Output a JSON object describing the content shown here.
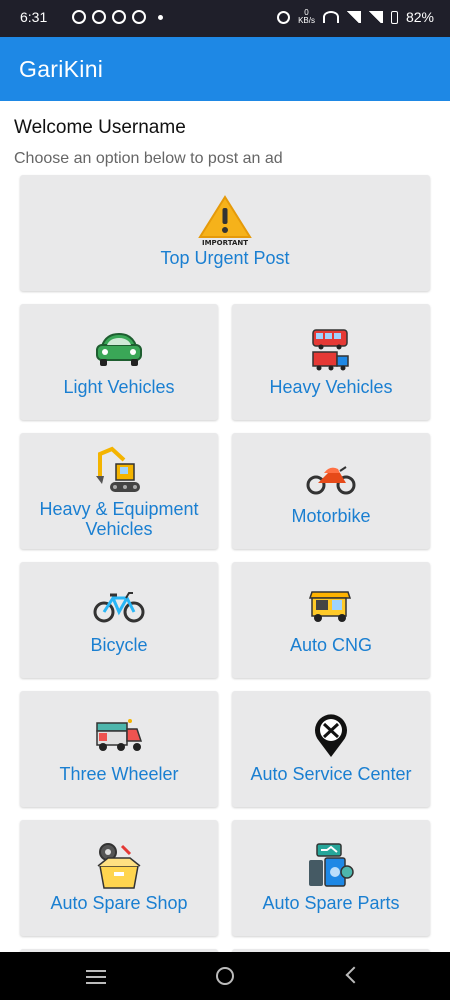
{
  "status_bar": {
    "time": "6:31",
    "network_speed_value": "0",
    "network_speed_unit": "KB/s",
    "battery": "82%"
  },
  "app_bar": {
    "title": "GariKini"
  },
  "header": {
    "welcome": "Welcome Username",
    "subtitle": "Choose an option below to post an ad"
  },
  "top_card": {
    "label": "Top Urgent Post",
    "icon": "warning-icon",
    "icon_text": "IMPORTANT"
  },
  "categories": [
    {
      "label": "Light Vehicles",
      "icon": "car-icon"
    },
    {
      "label": "Heavy Vehicles",
      "icon": "bus-truck-icon"
    },
    {
      "label": "Heavy & Equipment Vehicles",
      "icon": "excavator-icon"
    },
    {
      "label": "Motorbike",
      "icon": "motorbike-icon"
    },
    {
      "label": "Bicycle",
      "icon": "bicycle-icon"
    },
    {
      "label": "Auto CNG",
      "icon": "auto-rickshaw-icon"
    },
    {
      "label": "Three Wheeler",
      "icon": "three-wheeler-icon"
    },
    {
      "label": "Auto Service Center",
      "icon": "service-location-icon"
    },
    {
      "label": "Auto Spare Shop",
      "icon": "spare-box-icon"
    },
    {
      "label": "Auto Spare Parts",
      "icon": "engine-parts-icon"
    }
  ],
  "colors": {
    "app_bar": "#1e88e5",
    "card_background": "#e9e9ea",
    "card_label": "#1a7fd1"
  }
}
